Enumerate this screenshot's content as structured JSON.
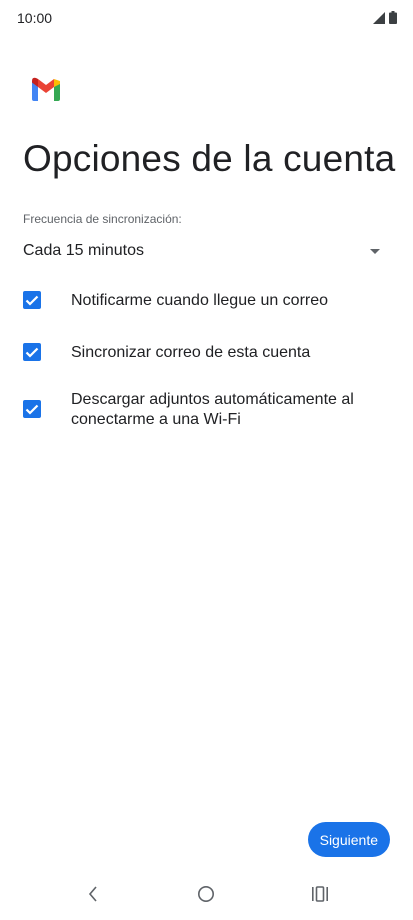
{
  "status_bar": {
    "time": "10:00",
    "icons": [
      "signal-icon",
      "battery-icon"
    ]
  },
  "app": {
    "logo": "gmail-logo",
    "colors": {
      "accent": "#1a73e8",
      "logo_red": "#ea4335",
      "logo_blue": "#4285f4",
      "logo_green": "#34a853",
      "logo_yellow": "#fbbc04"
    }
  },
  "page": {
    "title": "Opciones de la cuenta"
  },
  "sync": {
    "label": "Frecuencia de sincronización:",
    "selected": "Cada 15 minutos"
  },
  "options": [
    {
      "label": "Notificarme cuando llegue un correo",
      "checked": true
    },
    {
      "label": "Sincronizar correo de esta cuenta",
      "checked": true
    },
    {
      "label": "Descargar adjuntos automáticamente al conectarme a una Wi-Fi",
      "checked": true
    }
  ],
  "actions": {
    "next_label": "Siguiente"
  },
  "nav": {
    "icons": [
      "back-icon",
      "home-icon",
      "recents-icon"
    ]
  }
}
